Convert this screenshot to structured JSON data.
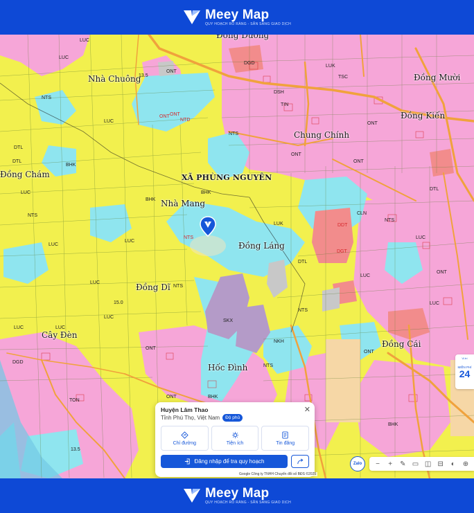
{
  "brand": {
    "name": "Meey Map",
    "tagline": "QUY HOẠCH RÕ RÀNG - SẴN SÀNG GIAO DỊCH"
  },
  "places": {
    "dong_duong": "Đồng Dương",
    "nha_chuong": "Nhà Chuông",
    "dong_muoi": "Đồng Mười",
    "dong_kien": "Đồng Kiến",
    "chung_chinh": "Chung Chính",
    "dong_cham": "Đồng Chám",
    "xa_phung_nguyen": "XÃ PHÙNG NGUYÊN",
    "nha_mang": "Nhà Mang",
    "dong_lang": "Đồng Láng",
    "dong_di": "Đồng Dĩ",
    "cay_den": "Cây Đèn",
    "dong_cai": "Đồng Cái",
    "hoc_dinh": "Hốc Đình"
  },
  "land_codes": [
    {
      "t": "LUC",
      "c": 0
    },
    {
      "t": "LUC",
      "c": 0
    },
    {
      "t": "NTS",
      "c": 0
    },
    {
      "t": "ONT",
      "c": 0
    },
    {
      "t": "DTL",
      "c": 0
    },
    {
      "t": "BHK",
      "c": 0
    },
    {
      "t": "DGD",
      "c": 0
    },
    {
      "t": "ONT",
      "c": 1
    },
    {
      "t": "NTD",
      "c": 1
    },
    {
      "t": "LUK",
      "c": 0
    },
    {
      "t": "TSC",
      "c": 0
    },
    {
      "t": "DSH",
      "c": 0
    },
    {
      "t": "DDT",
      "c": 1
    },
    {
      "t": "SKX",
      "c": 0
    },
    {
      "t": "NKH",
      "c": 0
    },
    {
      "t": "CLN",
      "c": 0
    },
    {
      "t": "TON",
      "c": 0
    },
    {
      "t": "DGT",
      "c": 1
    },
    {
      "t": "TIN",
      "c": 0
    },
    {
      "t": "NTS",
      "c": 1
    },
    {
      "t": "LUC",
      "c": 0
    },
    {
      "t": "ONT",
      "c": 0
    },
    {
      "t": "LUC",
      "c": 0
    },
    {
      "t": "NTS",
      "c": 0
    },
    {
      "t": "DTL",
      "c": 0
    },
    {
      "t": "ONT",
      "c": 0
    },
    {
      "t": "BHK",
      "c": 0
    },
    {
      "t": "LUC",
      "c": 0
    },
    {
      "t": "LUC",
      "c": 0
    },
    {
      "t": "NTS",
      "c": 0
    },
    {
      "t": "ONT",
      "c": 0
    },
    {
      "t": "LUC",
      "c": 0
    },
    {
      "t": "DGD",
      "c": 0
    },
    {
      "t": "LUC",
      "c": 0
    },
    {
      "t": "ONT",
      "c": 0
    },
    {
      "t": "NTS",
      "c": 0
    },
    {
      "t": "BHK",
      "c": 0
    },
    {
      "t": "LUC",
      "c": 0
    },
    {
      "t": "DTL",
      "c": 0
    },
    {
      "t": "ONT",
      "c": 1
    },
    {
      "t": "LUC",
      "c": 0
    },
    {
      "t": "NTS",
      "c": 0
    },
    {
      "t": "LUK",
      "c": 0
    },
    {
      "t": "ONT",
      "c": 0
    },
    {
      "t": "BHK",
      "c": 0
    },
    {
      "t": "LUC",
      "c": 0
    },
    {
      "t": "NTS",
      "c": 0
    },
    {
      "t": "LUC",
      "c": 0
    },
    {
      "t": "DTL",
      "c": 0
    },
    {
      "t": "ONT",
      "c": 0
    },
    {
      "t": "NTS",
      "c": 0
    },
    {
      "t": "LUC",
      "c": 0
    },
    {
      "t": "ONT",
      "c": 0
    },
    {
      "t": "BHK",
      "c": 0
    }
  ],
  "elevation_values": [
    "13.5",
    "15.0",
    "13.5"
  ],
  "info_card": {
    "title": "Huyện Lâm Thao",
    "subtitle": "Tỉnh Phú Thọ, Việt Nam",
    "badge": "Độ phủ",
    "actions": [
      {
        "label": "Chỉ đường",
        "icon": "directions-icon"
      },
      {
        "label": "Tiện ích",
        "icon": "amenities-icon"
      },
      {
        "label": "Tin đăng",
        "icon": "listings-icon"
      }
    ],
    "login_label": "Đăng nhập để tra quy hoạch"
  },
  "attribution": "Google  Công ty TNHH Chuyển đổi số BĐS ©2025",
  "zalo_label": "Zalo",
  "side_tab": {
    "line1": "Vị trí",
    "line2": "MIỀN PHÍ",
    "value": "24"
  },
  "colors": {
    "rice_land": "#f2f04e",
    "residential": "#f6a6d8",
    "aquaculture": "#8fe5ef",
    "public": "#f28c8c",
    "industrial": "#b49bc8",
    "road": "#f0a23c",
    "accent": "#1657d9"
  }
}
